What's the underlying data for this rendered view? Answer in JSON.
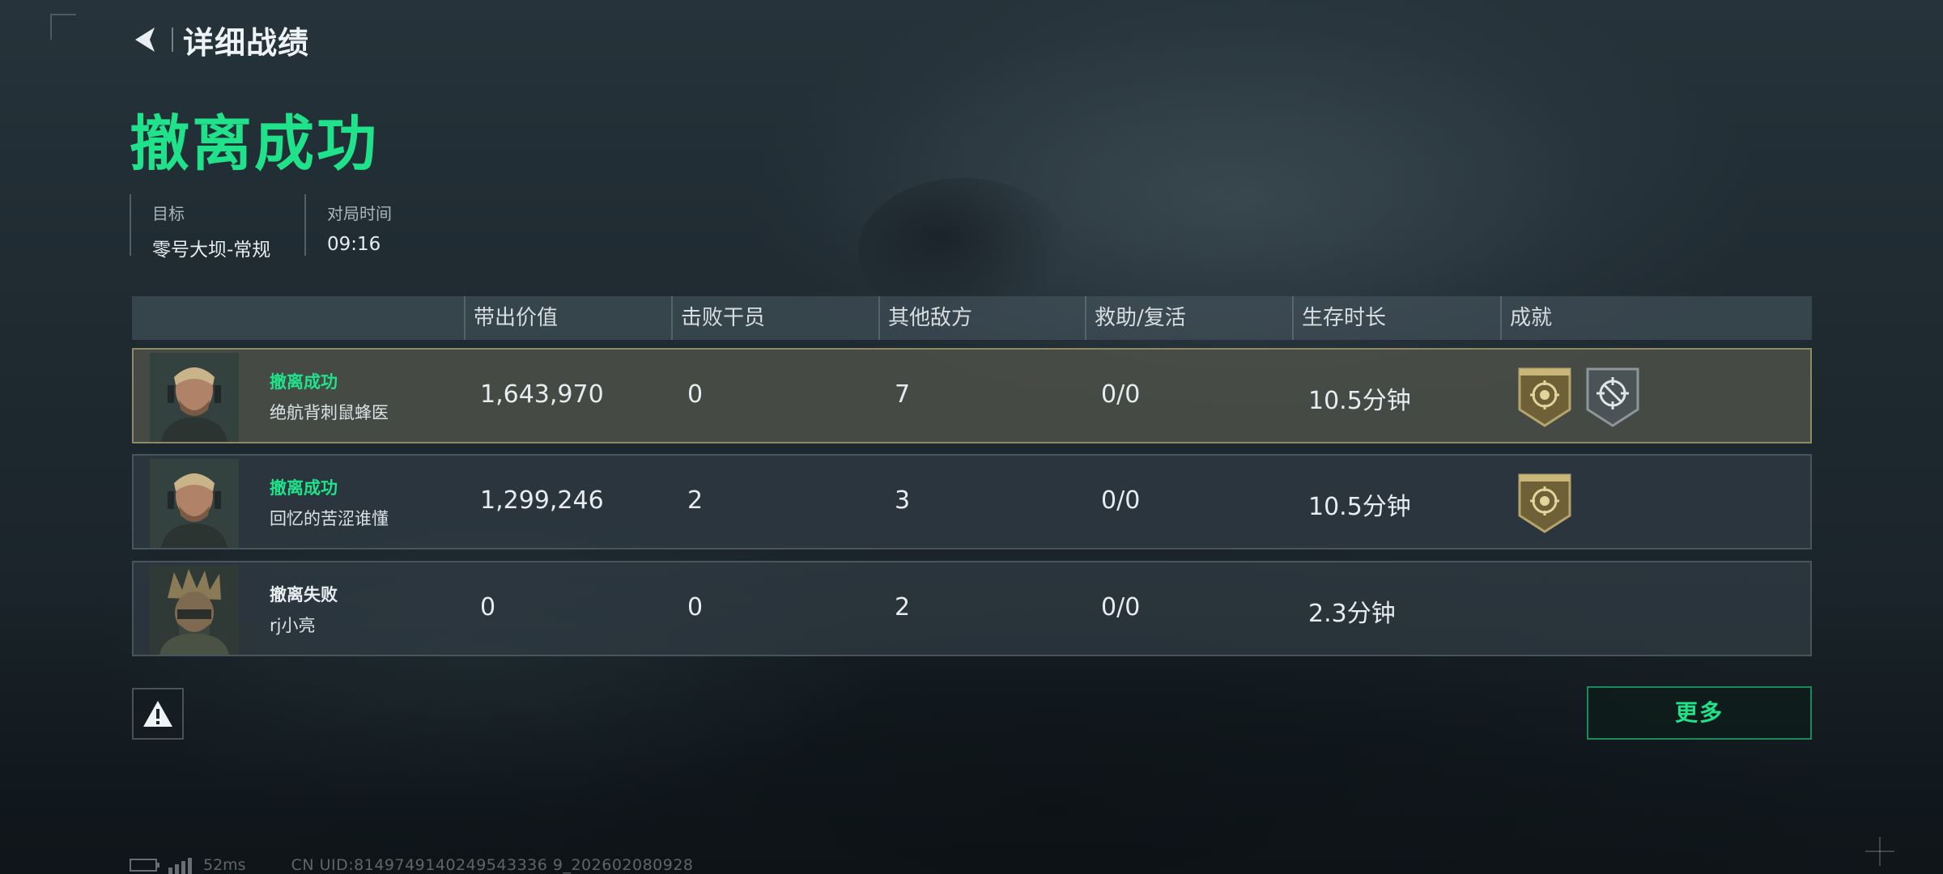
{
  "header": {
    "title": "详细战绩"
  },
  "result": {
    "title": "撤离成功"
  },
  "info": {
    "goal_label": "目标",
    "goal_value": "零号大坝-常规",
    "time_label": "对局时间",
    "time_value": "09:16"
  },
  "table": {
    "columns": [
      "带出价值",
      "击败干员",
      "其他敌方",
      "救助/复活",
      "生存时长",
      "成就"
    ],
    "rows": [
      {
        "status": "撤离成功",
        "status_type": "success",
        "name": "绝航背刺鼠蜂医",
        "value": "1,643,970",
        "kills": "0",
        "other": "7",
        "assist": "0/0",
        "survival": "10.5分钟",
        "badges": [
          "gold-shield-badge",
          "silver-crosshair-badge"
        ],
        "highlight": true
      },
      {
        "status": "撤离成功",
        "status_type": "success",
        "name": "回忆的苦涩谁懂",
        "value": "1,299,246",
        "kills": "2",
        "other": "3",
        "assist": "0/0",
        "survival": "10.5分钟",
        "badges": [
          "gold-shield-badge"
        ],
        "highlight": false
      },
      {
        "status": "撤离失败",
        "status_type": "fail",
        "name": "rj小亮",
        "value": "0",
        "kills": "0",
        "other": "2",
        "assist": "0/0",
        "survival": "2.3分钟",
        "badges": [],
        "highlight": false
      }
    ]
  },
  "buttons": {
    "more": "更多"
  },
  "footer": {
    "ping": "52ms",
    "uid": "CN UID:8149749140249543336 9_202602080928"
  },
  "colors": {
    "accent_green": "#1fe28a",
    "highlight_border": "#8f8a66",
    "badge_gold": "#8a7a4a",
    "badge_silver": "#5a6266"
  }
}
